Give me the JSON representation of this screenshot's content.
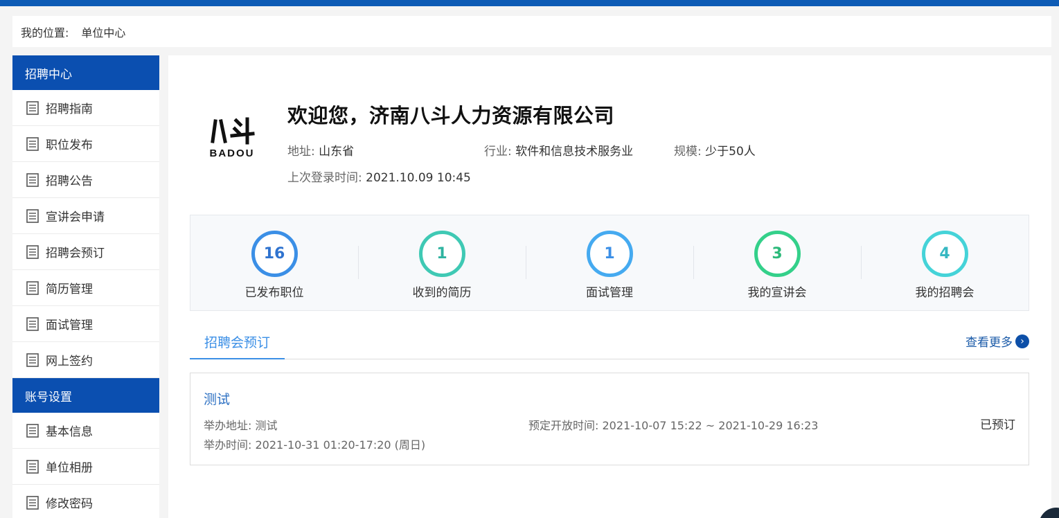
{
  "breadcrumb": {
    "prefix": "我的位置:",
    "current": "单位中心"
  },
  "sidebar": {
    "sections": [
      {
        "title": "招聘中心",
        "items": [
          "招聘指南",
          "职位发布",
          "招聘公告",
          "宣讲会申请",
          "招聘会预订",
          "简历管理",
          "面试管理",
          "网上签约"
        ]
      },
      {
        "title": "账号设置",
        "items": [
          "基本信息",
          "单位相册",
          "修改密码"
        ]
      }
    ]
  },
  "profile": {
    "logo_text": "BADOU",
    "logo_mark": "八斗",
    "welcome": "欢迎您，济南八斗人力资源有限公司",
    "address_label": "地址:",
    "address": "山东省",
    "industry_label": "行业:",
    "industry": "软件和信息技术服务业",
    "scale_label": "规模:",
    "scale": "少于50人",
    "last_login_label": "上次登录时间:",
    "last_login": "2021.10.09 10:45"
  },
  "stats": [
    {
      "value": "16",
      "label": "已发布职位",
      "color": "#3b8fe6",
      "text_color": "#2f73cf"
    },
    {
      "value": "1",
      "label": "收到的简历",
      "color": "#3fc9b4",
      "text_color": "#2fb3a0"
    },
    {
      "value": "1",
      "label": "面试管理",
      "color": "#45aaf0",
      "text_color": "#3b8fe6"
    },
    {
      "value": "3",
      "label": "我的宣讲会",
      "color": "#34d08a",
      "text_color": "#2cb97a"
    },
    {
      "value": "4",
      "label": "我的招聘会",
      "color": "#45d3d8",
      "text_color": "#36b8c2"
    }
  ],
  "tabs": {
    "active": "招聘会预订",
    "more": "查看更多"
  },
  "booking": {
    "title": "测试",
    "address_label": "举办地址:",
    "address": "测试",
    "time_label": "举办时间:",
    "time": "2021-10-31 01:20-17:20 (周日)",
    "open_label": "预定开放时间:",
    "open_time": "2021-10-07 15:22 ~ 2021-10-29 16:23",
    "status": "已预订"
  }
}
